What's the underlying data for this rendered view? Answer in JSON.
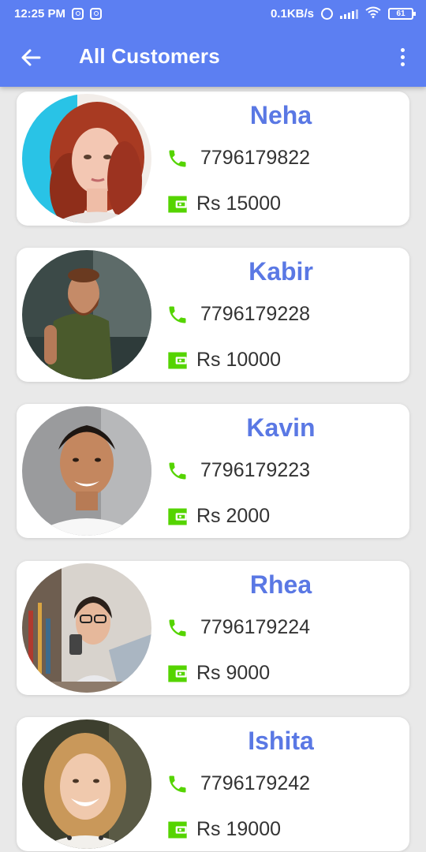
{
  "status_bar": {
    "time": "12:25 PM",
    "network_speed": "0.1KB/s",
    "battery": "61",
    "icons": [
      "instagram-icon",
      "instagram-icon",
      "alarm-icon",
      "signal-icon",
      "wifi-icon",
      "battery-icon"
    ]
  },
  "toolbar": {
    "title": "All Customers",
    "back_icon": "arrow-back-icon",
    "menu_icon": "more-vert-icon"
  },
  "colors": {
    "appbar": "#5c7ff2",
    "name_text": "#5a78e4",
    "icon_green": "#55d400",
    "card": "#ffffff",
    "background": "#e9e9e9"
  },
  "customers": [
    {
      "name": "Neha",
      "phone": "7796179822",
      "balance": "Rs 15000",
      "photo": "woman-red-hair-portrait"
    },
    {
      "name": "Kabir",
      "phone": "7796179228",
      "balance": "Rs 10000",
      "photo": "bearded-man-green-shirt"
    },
    {
      "name": "Kavin",
      "phone": "7796179223",
      "balance": "Rs 2000",
      "photo": "smiling-man-white-shirt"
    },
    {
      "name": "Rhea",
      "phone": "7796179224",
      "balance": "Rs 9000",
      "photo": "woman-glasses-laptop"
    },
    {
      "name": "Ishita",
      "phone": "7796179242",
      "balance": "Rs 19000",
      "photo": "smiling-woman-blonde"
    }
  ]
}
